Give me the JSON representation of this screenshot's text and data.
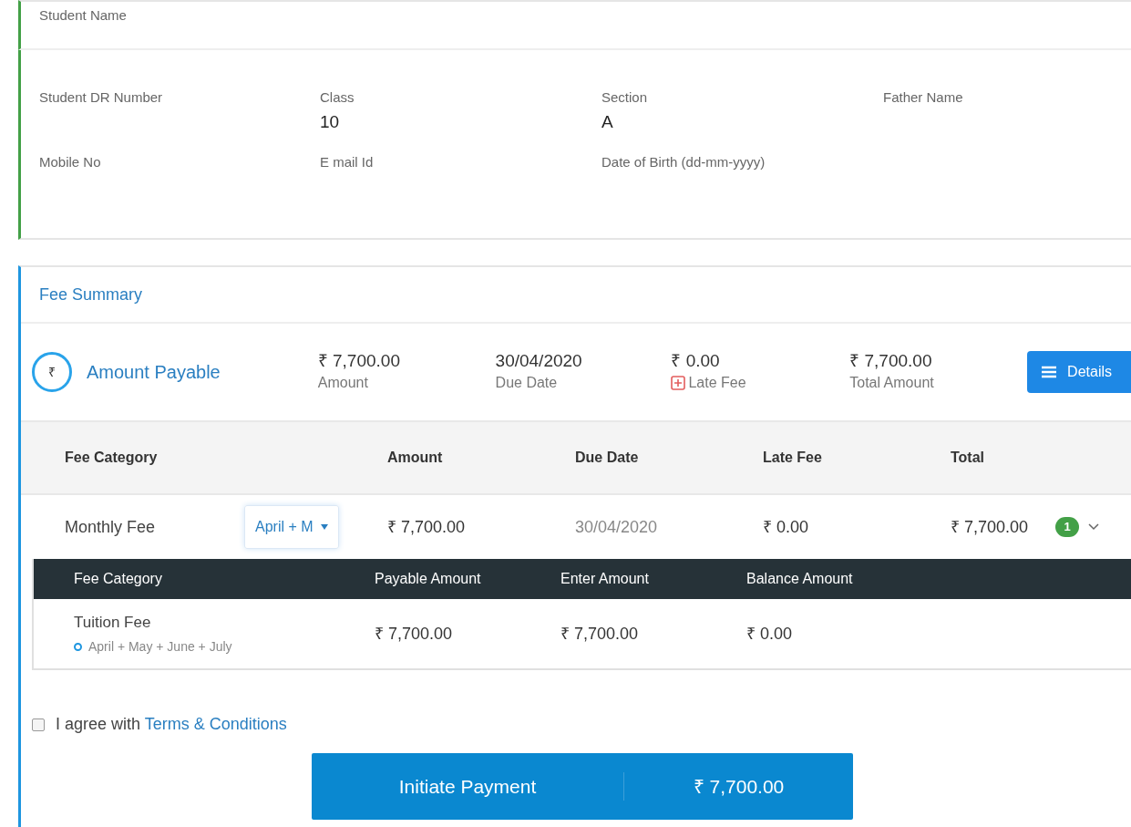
{
  "student_name_label": "Student Name",
  "fields": [
    {
      "label": "Student DR Number"
    },
    {
      "label": "Class",
      "value": "10"
    },
    {
      "label": "Section",
      "value": "A"
    },
    {
      "label": "Father Name"
    },
    {
      "label": "Mobile No"
    },
    {
      "label": "E mail Id"
    },
    {
      "label": "Date of Birth (dd-mm-yyyy)"
    }
  ],
  "fee_summary": {
    "title": "Fee Summary",
    "symbol": "₹",
    "heading": "Amount Payable",
    "stats": [
      {
        "value": "₹ 7,700.00",
        "label": "Amount",
        "kind": "plain"
      },
      {
        "value": "30/04/2020",
        "label": "Due Date",
        "kind": "plain"
      },
      {
        "value": "₹ 0.00",
        "label": "Late Fee",
        "kind": "late"
      },
      {
        "value": "₹ 7,700.00",
        "label": "Total Amount",
        "kind": "plain"
      }
    ],
    "details_button": "Details"
  },
  "table": {
    "columns": [
      "Fee Category",
      "Amount",
      "Due Date",
      "Late Fee",
      "Total"
    ],
    "rows": [
      {
        "category": "Monthly Fee",
        "period": "April + M",
        "amount": "₹ 7,700.00",
        "due_date": "30/04/2020",
        "late_fee": "₹ 0.00",
        "total": "₹ 7,700.00",
        "count": "1",
        "expanded": true
      }
    ]
  },
  "sub_table": {
    "columns": [
      "Fee Category",
      "Payable Amount",
      "Enter Amount",
      "Balance Amount"
    ],
    "rows": [
      {
        "category": "Tuition Fee",
        "months": "April + May + June + July",
        "payable": "₹ 7,700.00",
        "entered": "₹ 7,700.00",
        "balance": "₹ 0.00"
      }
    ]
  },
  "agree": {
    "checked": false,
    "text": "I agree with",
    "link": "Terms & Conditions"
  },
  "pay_button": {
    "label": "Initiate Payment",
    "amount": "₹ 7,700.00"
  }
}
